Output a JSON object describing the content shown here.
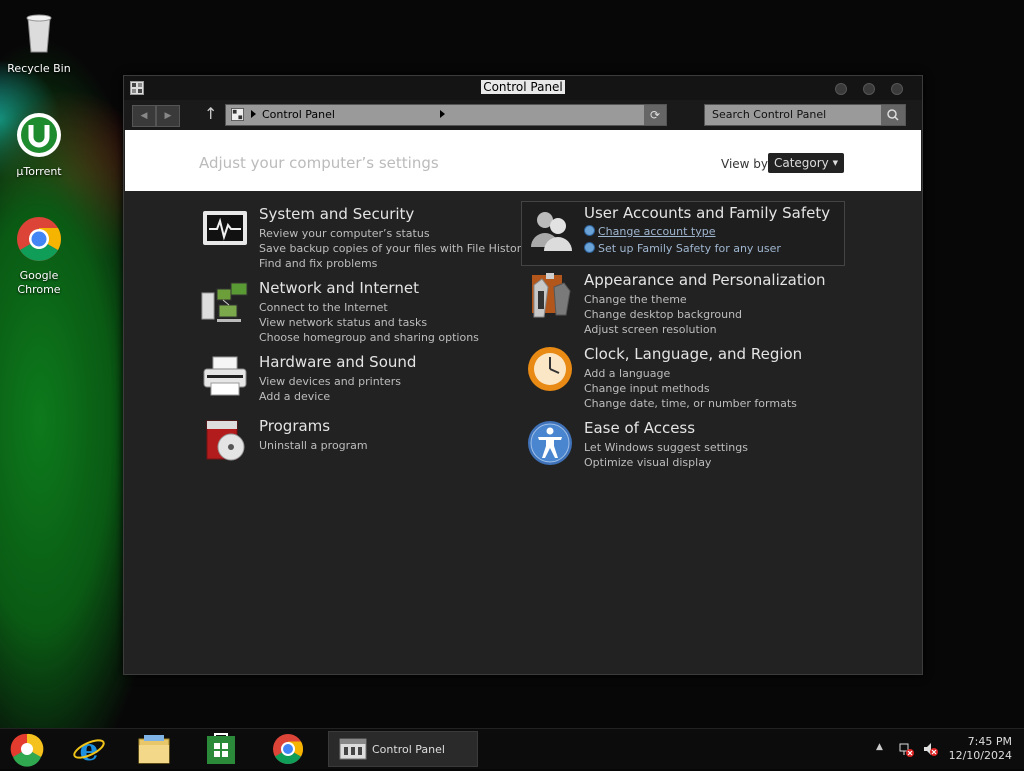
{
  "desktop": {
    "icons": [
      {
        "label": "Recycle Bin",
        "icon": "recycle-bin-icon"
      },
      {
        "label": "µTorrent",
        "icon": "utorrent-icon"
      },
      {
        "label_line1": "Google",
        "label_line2": "Chrome",
        "icon": "chrome-icon"
      }
    ]
  },
  "window": {
    "title": "Control Panel",
    "address": {
      "crumb": "Control Panel"
    },
    "search": {
      "placeholder": "Search Control Panel"
    },
    "header": {
      "adjust_text": "Adjust your computer’s settings",
      "view_by_label": "View by:",
      "view_by_value": "Category"
    }
  },
  "categories": {
    "left": [
      {
        "title": "System and Security",
        "icon": "monitor-pulse-icon",
        "links": [
          "Review your computer’s status",
          "Save backup copies of your files with File History",
          "Find and fix problems"
        ]
      },
      {
        "title": "Network and Internet",
        "icon": "network-computers-icon",
        "links": [
          "Connect to the Internet",
          "View network status and tasks",
          "Choose homegroup and sharing options"
        ]
      },
      {
        "title": "Hardware and Sound",
        "icon": "printer-icon",
        "links": [
          "View devices and printers",
          "Add a device"
        ]
      },
      {
        "title": "Programs",
        "icon": "programs-disc-icon",
        "links": [
          "Uninstall a program"
        ]
      }
    ],
    "right": [
      {
        "title": "User Accounts and Family Safety",
        "icon": "users-icon",
        "links": [
          "Change account type",
          "Set up Family Safety for any user"
        ]
      },
      {
        "title": "Appearance and Personalization",
        "icon": "appearance-icon",
        "links": [
          "Change the theme",
          "Change desktop background",
          "Adjust screen resolution"
        ]
      },
      {
        "title": "Clock, Language, and Region",
        "icon": "clock-icon",
        "links": [
          "Add a language",
          "Change input methods",
          "Change date, time, or number formats"
        ]
      },
      {
        "title": "Ease of Access",
        "icon": "accessibility-icon",
        "links": [
          "Let Windows suggest settings",
          "Optimize visual display"
        ]
      }
    ]
  },
  "taskbar": {
    "apps": [
      "start-icon",
      "internet-explorer-icon",
      "file-explorer-icon",
      "store-icon",
      "chrome-icon"
    ],
    "active_label": "Control Panel",
    "time": "7:45 PM",
    "date": "12/10/2024"
  }
}
